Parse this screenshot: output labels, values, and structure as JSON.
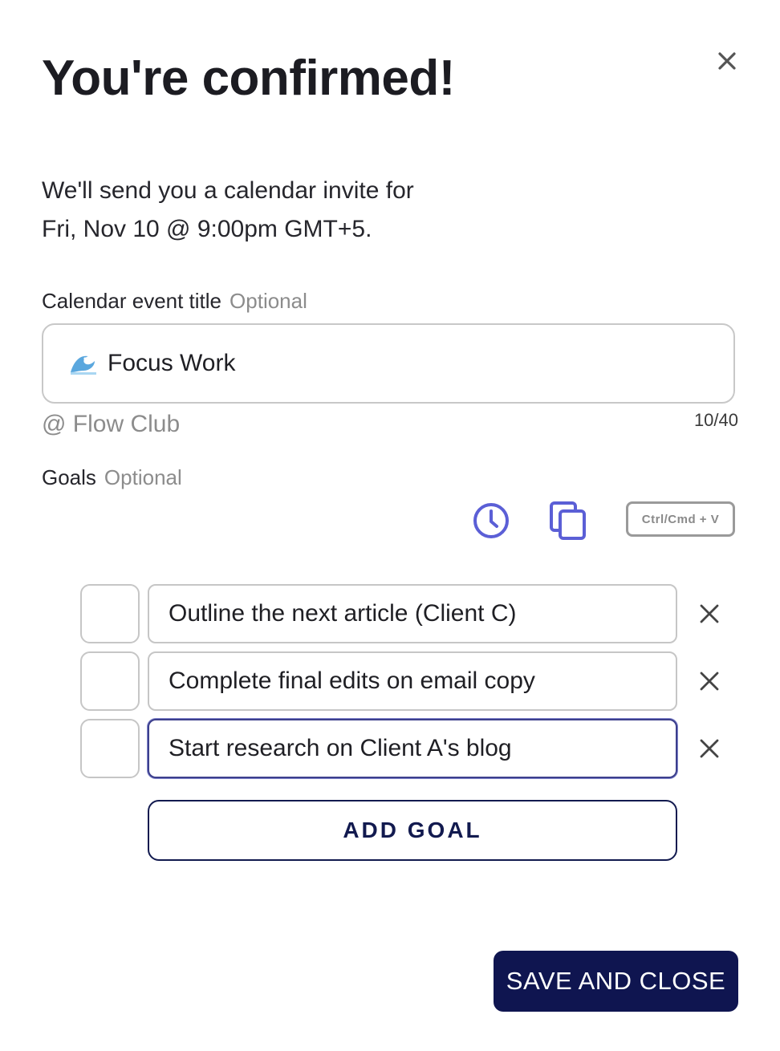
{
  "dialog": {
    "title": "You're confirmed!",
    "close_icon": "close-icon"
  },
  "invite": {
    "line1": "We'll send you a calendar invite for",
    "line2": "Fri, Nov 10 @ 9:00pm GMT+5."
  },
  "event_title": {
    "label": "Calendar event title",
    "optional": "Optional",
    "emoji_icon": "wave-emoji-icon",
    "value": "Focus Work",
    "suffix": "@ Flow Club",
    "char_count": "10/40"
  },
  "goals": {
    "label": "Goals",
    "optional": "Optional",
    "tools": {
      "clock_icon": "clock-icon",
      "copy_icon": "copy-icon",
      "paste_hint": "Ctrl/Cmd + V"
    },
    "items": [
      {
        "text": "Outline the next article (Client C)",
        "checked": false
      },
      {
        "text": "Complete final edits on email copy",
        "checked": false
      },
      {
        "text": "Start research on Client A's blog",
        "checked": false,
        "focused": true
      }
    ],
    "add_label": "ADD GOAL"
  },
  "footer": {
    "save_label": "SAVE AND CLOSE"
  },
  "colors": {
    "accent_icon": "#5b5fd6",
    "primary_button": "#0f1550",
    "muted_text": "#8c8c8c",
    "border": "#c8c8c8"
  }
}
